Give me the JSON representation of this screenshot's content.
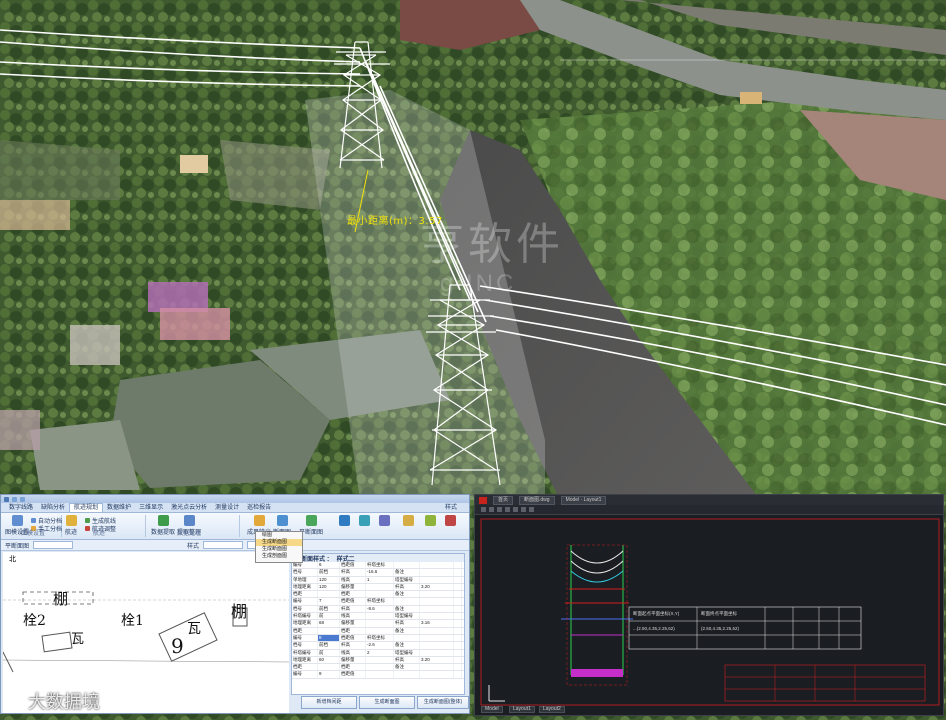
{
  "viewer": {
    "measure_label": "最小距离(m)：3.57",
    "watermark_text": "亨软件",
    "watermark_sub": "g INC"
  },
  "left_app": {
    "menus": [
      "数字线路",
      "缺陷分析",
      "航迹规划",
      "数据维护",
      "三维显示",
      "激光点云分析",
      "测量设计",
      "巡检报告",
      "样式"
    ],
    "active_menu": "航迹规划",
    "ribbon_groups": [
      {
        "caption": "图模设置",
        "buttons": [
          "图模设置",
          "自动分档",
          "手工分档"
        ]
      },
      {
        "caption": "航迹",
        "buttons": [
          "航迹",
          "生成航线",
          "航迹调整"
        ]
      },
      {
        "caption": "数据处理",
        "buttons": [
          "数据提取",
          "提取整理"
        ]
      },
      {
        "caption": "成果输出",
        "buttons": [
          "成果输出",
          "断面图",
          "平断面图"
        ]
      }
    ],
    "dropdown_items": [
      "绘图",
      "生成断面图",
      "生成断面图",
      "生成剖面图"
    ],
    "dropdown_selected": 1,
    "subbar": [
      "平断面图",
      "样式",
      "平断面图样式 ：",
      "样式二"
    ],
    "north_label": "北",
    "cad_labels": [
      "棚",
      "栓2",
      "瓦",
      "栓1",
      "瓦",
      "棚",
      "9"
    ],
    "properties_title": "平断面样式 ：",
    "properties_style": "样式二",
    "properties_rows": [
      [
        "编号",
        "6",
        "档距值",
        "杆塔坐标",
        "",
        "",
        ""
      ],
      [
        "档号",
        "前档",
        "杆高",
        "-16.6",
        "备注",
        "",
        ""
      ],
      [
        "单地理",
        "120",
        "线高",
        "1",
        "塔型编号",
        "",
        ""
      ],
      [
        "地理距离",
        "120",
        "偏移量",
        "",
        "杆高",
        "3.20",
        ""
      ],
      [
        "档距",
        "",
        "档距",
        "",
        "备注",
        "",
        ""
      ],
      [
        "编号",
        "7",
        "档距值",
        "杆塔坐标",
        "",
        "",
        ""
      ],
      [
        "档号",
        "前档",
        "杆高",
        "-8.6",
        "备注",
        "",
        ""
      ],
      [
        "杆塔编号",
        "前",
        "线高",
        "",
        "塔型编号",
        "",
        ""
      ],
      [
        "地理距离",
        "68",
        "偏移量",
        "",
        "杆高",
        "3.16",
        ""
      ],
      [
        "档距",
        "",
        "档距",
        "",
        "备注",
        "",
        ""
      ],
      [
        "编号",
        "8",
        "档距值",
        "杆塔坐标",
        "",
        "",
        ""
      ],
      [
        "档号",
        "前档",
        "杆高",
        "-2.6",
        "备注",
        "",
        ""
      ],
      [
        "杆塔编号",
        "前",
        "线高",
        "2",
        "塔型编号",
        "",
        ""
      ],
      [
        "地理距离",
        "60",
        "偏移量",
        "",
        "杆高",
        "3.20",
        ""
      ],
      [
        "档距",
        "",
        "档距",
        "",
        "备注",
        "",
        ""
      ],
      [
        "编号",
        "9",
        "档距值",
        "",
        "",
        "",
        ""
      ]
    ],
    "buttons": [
      "新增档间距",
      "生成断面图",
      "生成断面图(整体)"
    ]
  },
  "right_app": {
    "tabs": [
      "首页",
      "断面图.dwg",
      "Model · Layout1"
    ],
    "layout_tabs": [
      "Model",
      "Layout1",
      "Layout2"
    ],
    "table_rows": [
      [
        "断面起点平面坐标(X,Y)",
        "断面终点平面坐标",
        "",
        "",
        "",
        ""
      ],
      [
        "...(2.50,4.35,2.25,62)",
        "(2.50,4.35,2.25,62)",
        "",
        "",
        "",
        ""
      ],
      [
        "",
        "",
        "",
        "",
        "",
        ""
      ]
    ],
    "accent_colors": {
      "red": "#d41f1f",
      "green": "#2fd14a",
      "magenta": "#c62ec9",
      "cyan": "#35c8e0"
    }
  },
  "corner_watermark": "大数据境"
}
